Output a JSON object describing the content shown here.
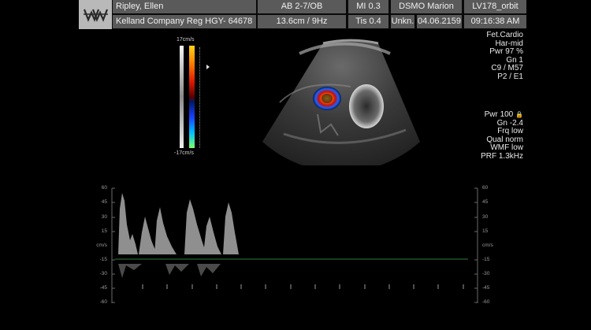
{
  "header": {
    "patient_name": "Ripley, Ellen",
    "preset": "AB 2-7/OB",
    "mi": "MI  0.3",
    "operator": "DSMO Marion",
    "probe_id": "LV178_orbit",
    "institution": "Kelland Company  Reg HGY- 64678",
    "depth_freq": "13.6cm / 9Hz",
    "tis": "Tis 0.4",
    "unkn": "Unkn.",
    "date": "04.06.2159",
    "time": "09:16:38 AM"
  },
  "imaging_params": [
    "Fet.Cardio",
    "Har-mid",
    "Pwr 97  %",
    "Gn    1",
    "C9 / M57",
    "P2 / E1"
  ],
  "color_params": [
    "Pwr 100",
    "Gn -2.4",
    "Frq low",
    "Qual norm",
    "WMF low",
    "PRF  1.3kHz"
  ],
  "colorbar": {
    "top_label": "17cm/s",
    "bottom_label": "-17cm/s"
  },
  "doppler_scale": {
    "left": [
      "60",
      "45",
      "30",
      "15",
      "cm/s",
      "-15",
      "-30",
      "-45",
      "-60"
    ],
    "right": [
      "60",
      "45",
      "30",
      "15",
      "cm/s",
      "-15",
      "-30",
      "-45",
      "-60"
    ]
  },
  "colors": {
    "header_cell": "#5a5a5a",
    "logo_bg": "#b9b9b9",
    "baseline": "#2e7d3a"
  }
}
